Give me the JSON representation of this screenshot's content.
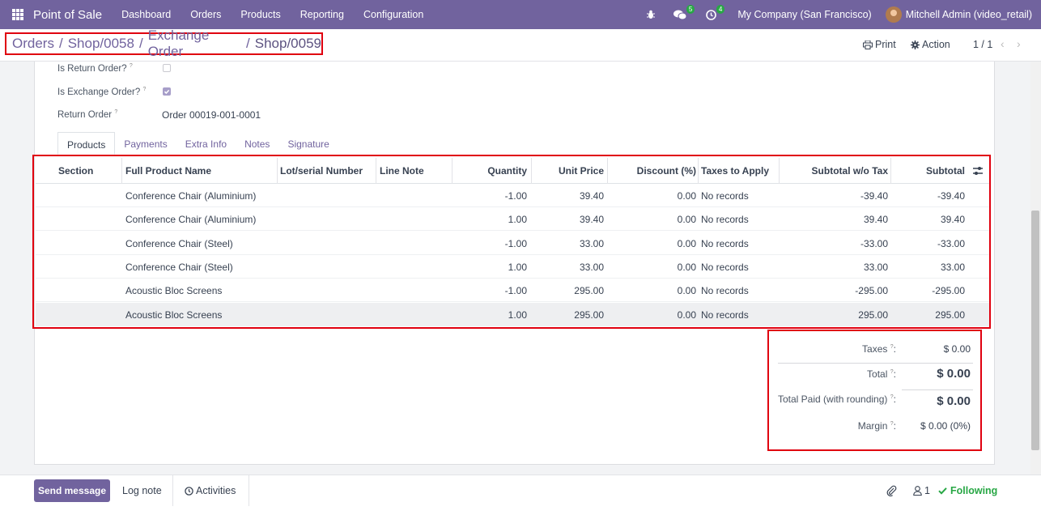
{
  "topbar": {
    "app_name": "Point of Sale",
    "menu": [
      "Dashboard",
      "Orders",
      "Products",
      "Reporting",
      "Configuration"
    ],
    "chat_count": "5",
    "activity_count": "4",
    "company": "My Company (San Francisco)",
    "user": "Mitchell Admin (video_retail)"
  },
  "breadcrumb": {
    "items": [
      "Orders",
      "Shop/0058",
      "Exchange Order"
    ],
    "separator": "/",
    "current": "Shop/0059"
  },
  "control_panel": {
    "print_label": "Print",
    "action_label": "Action",
    "pager": "1 / 1"
  },
  "form": {
    "is_return_label": "Is Return Order?",
    "is_return_checked": false,
    "is_exchange_label": "Is Exchange Order?",
    "is_exchange_checked": true,
    "return_order_label": "Return Order",
    "return_order_value": "Order 00019-001-0001",
    "help_mark": "?"
  },
  "tabs": [
    "Products",
    "Payments",
    "Extra Info",
    "Notes",
    "Signature"
  ],
  "table": {
    "headers": [
      "Section",
      "Full Product Name",
      "Lot/serial Number",
      "Line Note",
      "Quantity",
      "Unit Price",
      "Discount (%)",
      "Taxes to Apply",
      "Subtotal w/o Tax",
      "Subtotal"
    ],
    "rows": [
      {
        "section": "",
        "product": "Conference Chair (Aluminium)",
        "lot": "",
        "note": "",
        "qty": "-1.00",
        "price": "39.40",
        "discount": "0.00",
        "taxes": "No records",
        "subtotal_wo": "-39.40",
        "subtotal": "-39.40"
      },
      {
        "section": "",
        "product": "Conference Chair (Aluminium)",
        "lot": "",
        "note": "",
        "qty": "1.00",
        "price": "39.40",
        "discount": "0.00",
        "taxes": "No records",
        "subtotal_wo": "39.40",
        "subtotal": "39.40"
      },
      {
        "section": "",
        "product": "Conference Chair (Steel)",
        "lot": "",
        "note": "",
        "qty": "-1.00",
        "price": "33.00",
        "discount": "0.00",
        "taxes": "No records",
        "subtotal_wo": "-33.00",
        "subtotal": "-33.00"
      },
      {
        "section": "",
        "product": "Conference Chair (Steel)",
        "lot": "",
        "note": "",
        "qty": "1.00",
        "price": "33.00",
        "discount": "0.00",
        "taxes": "No records",
        "subtotal_wo": "33.00",
        "subtotal": "33.00"
      },
      {
        "section": "",
        "product": "Acoustic Bloc Screens",
        "lot": "",
        "note": "",
        "qty": "-1.00",
        "price": "295.00",
        "discount": "0.00",
        "taxes": "No records",
        "subtotal_wo": "-295.00",
        "subtotal": "-295.00"
      },
      {
        "section": "",
        "product": "Acoustic Bloc Screens",
        "lot": "",
        "note": "",
        "qty": "1.00",
        "price": "295.00",
        "discount": "0.00",
        "taxes": "No records",
        "subtotal_wo": "295.00",
        "subtotal": "295.00"
      }
    ]
  },
  "totals": {
    "taxes_label": "Taxes",
    "taxes_value": "$ 0.00",
    "total_label": "Total",
    "total_value": "$ 0.00",
    "paid_label": "Total Paid (with rounding)",
    "paid_value": "$ 0.00",
    "margin_label": "Margin",
    "margin_value": "$ 0.00 (0%)"
  },
  "chatter": {
    "send_label": "Send message",
    "log_label": "Log note",
    "activities_label": "Activities",
    "followers_count": "1",
    "following_label": "Following"
  },
  "colors": {
    "brand": "#71639e",
    "highlight": "#e0000f",
    "success": "#28a745"
  }
}
